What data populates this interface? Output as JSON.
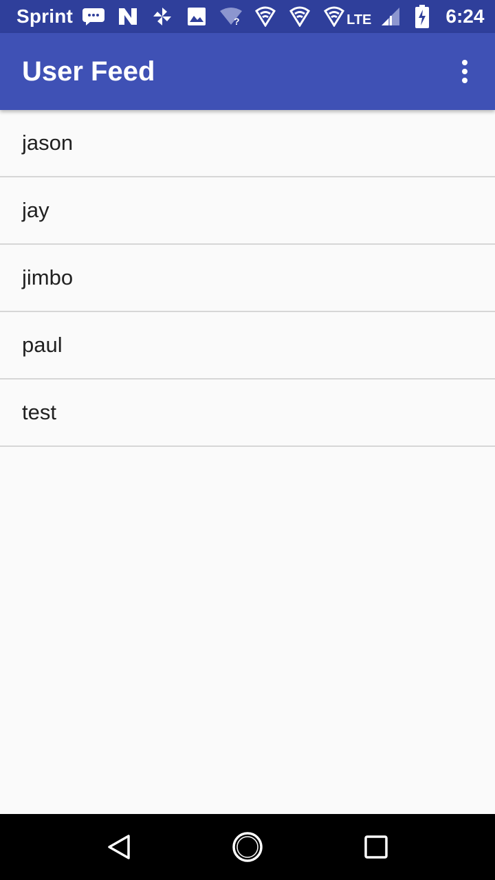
{
  "status_bar": {
    "carrier": "Sprint",
    "network": "LTE",
    "time": "6:24",
    "notification_icons": [
      "message-icon",
      "n-app-icon",
      "pinwheel-icon",
      "image-icon",
      "wifi-question-icon",
      "vpn-shield-icon",
      "vpn-shield-icon",
      "vpn-shield-icon"
    ],
    "system_icons": [
      "lte-signal-icon",
      "battery-charging-icon"
    ]
  },
  "app_bar": {
    "title": "User Feed",
    "menu_icon": "overflow-menu-icon",
    "color": "#3f51b5"
  },
  "feed": {
    "items": [
      {
        "label": "jason"
      },
      {
        "label": "jay"
      },
      {
        "label": "jimbo"
      },
      {
        "label": "paul"
      },
      {
        "label": "test"
      }
    ]
  },
  "nav_bar": {
    "icons": [
      "back-icon",
      "home-icon",
      "recents-icon"
    ]
  }
}
